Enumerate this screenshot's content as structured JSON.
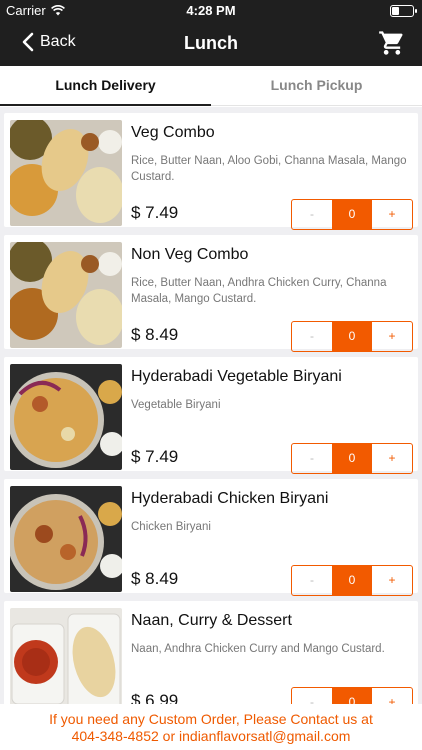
{
  "status_bar": {
    "carrier": "Carrier",
    "time": "4:28 PM",
    "wifi_icon": "wifi-icon",
    "battery_icon": "battery-icon"
  },
  "nav": {
    "back_label": "Back",
    "title": "Lunch",
    "cart_icon": "cart-icon"
  },
  "tabs": [
    {
      "label": "Lunch Delivery",
      "active": true
    },
    {
      "label": "Lunch Pickup",
      "active": false
    }
  ],
  "items": [
    {
      "name": "Veg Combo",
      "description": "Rice, Butter Naan, Aloo Gobi, Channa Masala, Mango Custard.",
      "price": "$ 7.49",
      "quantity": "0",
      "minus": "-",
      "plus": "+"
    },
    {
      "name": "Non Veg Combo",
      "description": "Rice, Butter Naan, Andhra Chicken Curry, Channa Masala, Mango Custard.",
      "price": "$ 8.49",
      "quantity": "0",
      "minus": "-",
      "plus": "+"
    },
    {
      "name": "Hyderabadi Vegetable Biryani",
      "description": "Vegetable Biryani",
      "price": "$ 7.49",
      "quantity": "0",
      "minus": "-",
      "plus": "+"
    },
    {
      "name": "Hyderabadi Chicken  Biryani",
      "description": "Chicken Biryani",
      "price": "$ 8.49",
      "quantity": "0",
      "minus": "-",
      "plus": "+"
    },
    {
      "name": "Naan, Curry & Dessert",
      "description": "Naan,  Andhra Chicken Curry and Mango Custard.",
      "price": "$ 6.99",
      "quantity": "0",
      "minus": "-",
      "plus": "+"
    }
  ],
  "footer": {
    "line1": "If you need any Custom Order, Please Contact us at",
    "line2": "404-348-4852 or indianflavorsatl@gmail.com"
  },
  "colors": {
    "accent": "#f25a00",
    "header_bg": "#1f1f1f",
    "list_bg": "#efeff2"
  }
}
